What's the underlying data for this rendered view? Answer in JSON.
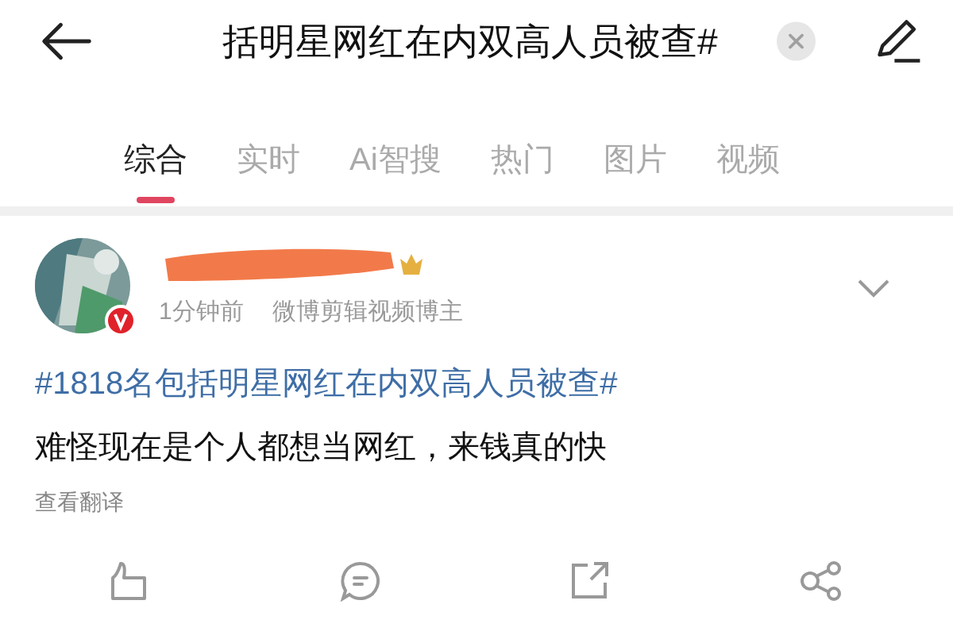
{
  "search": {
    "value": "括明星网红在内双高人员被查#"
  },
  "tabs": [
    {
      "label": "综合",
      "selected": true
    },
    {
      "label": "实时",
      "selected": false
    },
    {
      "label": "Ai智搜",
      "selected": false
    },
    {
      "label": "热门",
      "selected": false
    },
    {
      "label": "图片",
      "selected": false
    },
    {
      "label": "视频",
      "selected": false
    }
  ],
  "post": {
    "verified": true,
    "time": "1分钟前",
    "source": "微博剪辑视频博主",
    "hashtag": "#1818名包括明星网红在内双高人员被查#",
    "text": "难怪现在是个人都想当网红，来钱真的快",
    "translate": "查看翻译"
  }
}
